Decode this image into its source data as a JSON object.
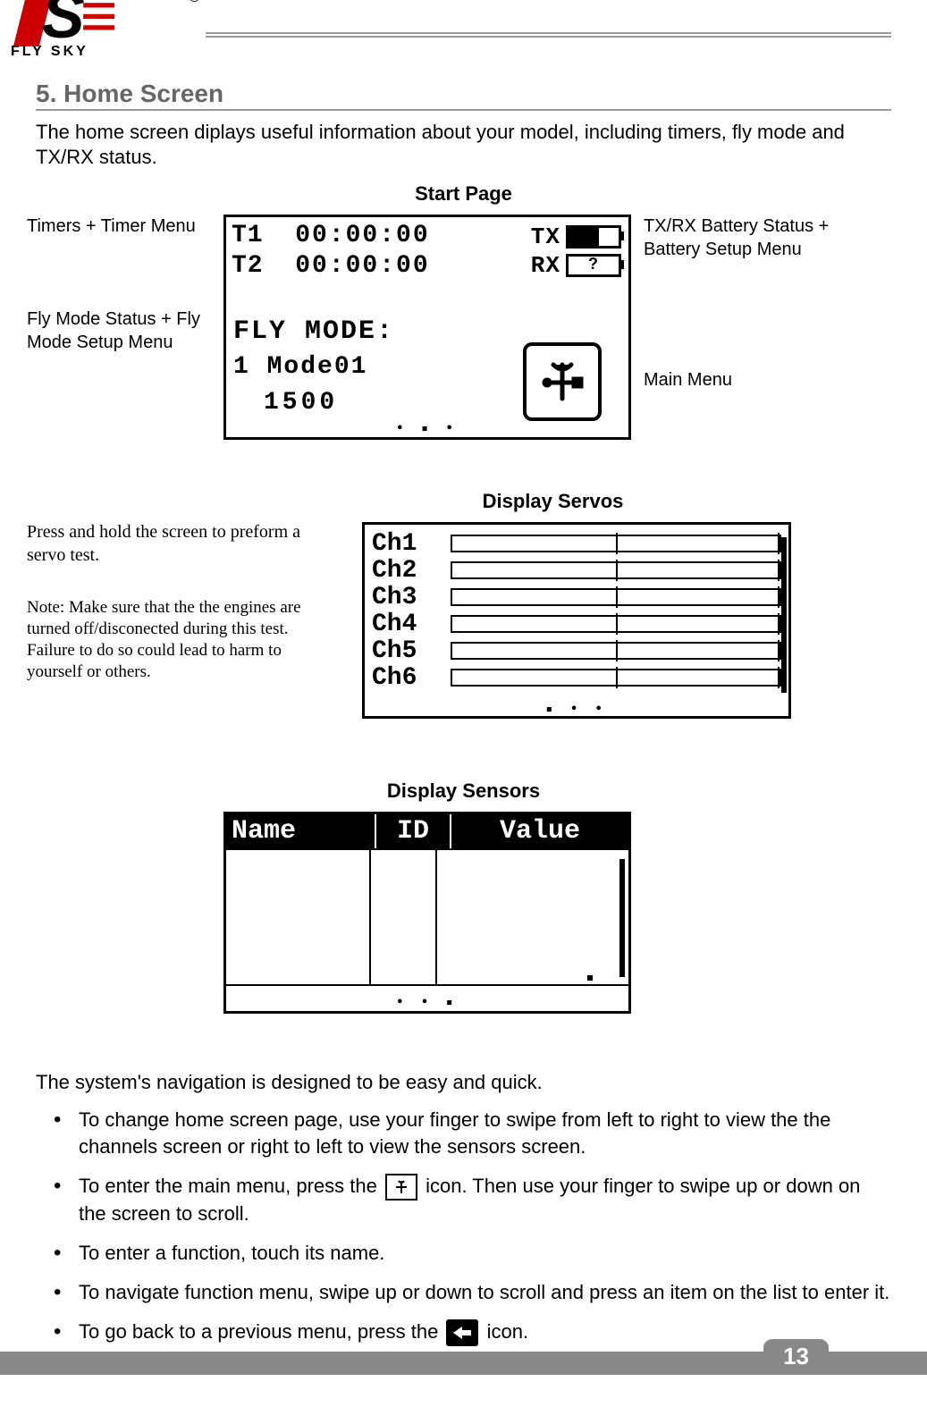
{
  "brand": {
    "name": "FLY SKY",
    "registered": "®"
  },
  "heading": "5. Home Screen",
  "intro": "The home screen diplays useful information about your model, including timers, fly mode and TX/RX status.",
  "start": {
    "caption": "Start Page",
    "callouts": {
      "timers": "Timers + Timer Menu",
      "fly": "Fly Mode Status + Fly Mode Setup Menu",
      "batt": "TX/RX Battery Status + Battery Setup Menu",
      "main": "Main Menu"
    },
    "timers": {
      "t1_label": "T1",
      "t1_value": "00:00:00",
      "t2_label": "T2",
      "t2_value": "00:00:00"
    },
    "tx_label": "TX",
    "rx_label": "RX",
    "rx_unknown": "?",
    "fly": {
      "title": "FLY MODE:",
      "line2": "1  Mode01",
      "line3": "1500"
    },
    "pager": "• ▪ •"
  },
  "servos": {
    "caption": "Display Servos",
    "instruction": "Press and hold the screen to preform a servo test.",
    "warning": "Note: Make sure that the the engines are turned off/disconected during this test. Failure to do so could lead to harm to yourself or others.",
    "channels": [
      "Ch1",
      "Ch2",
      "Ch3",
      "Ch4",
      "Ch5",
      "Ch6"
    ],
    "pager": "▪ • •"
  },
  "sensors": {
    "caption": "Display Sensors",
    "headers": {
      "name": "Name",
      "id": "ID",
      "value": "Value"
    },
    "pager": "• • ▪"
  },
  "nav": {
    "lead": "The system's navigation is designed to be easy and quick.",
    "b1": "To change home screen page, use your finger to swipe from left to right to view the the channels screen or right to left to view the sensors screen.",
    "b2a": "To enter the main menu, press the ",
    "b2b": " icon. Then use your finger to swipe up or down on the screen to scroll.",
    "b3": "To enter a function, touch its name.",
    "b4": "To navigate function menu, swipe up or down to scroll and press an item on the list to enter it.",
    "b5a": "To go back to a previous menu, press the ",
    "b5b": " icon."
  },
  "page_number": "13"
}
